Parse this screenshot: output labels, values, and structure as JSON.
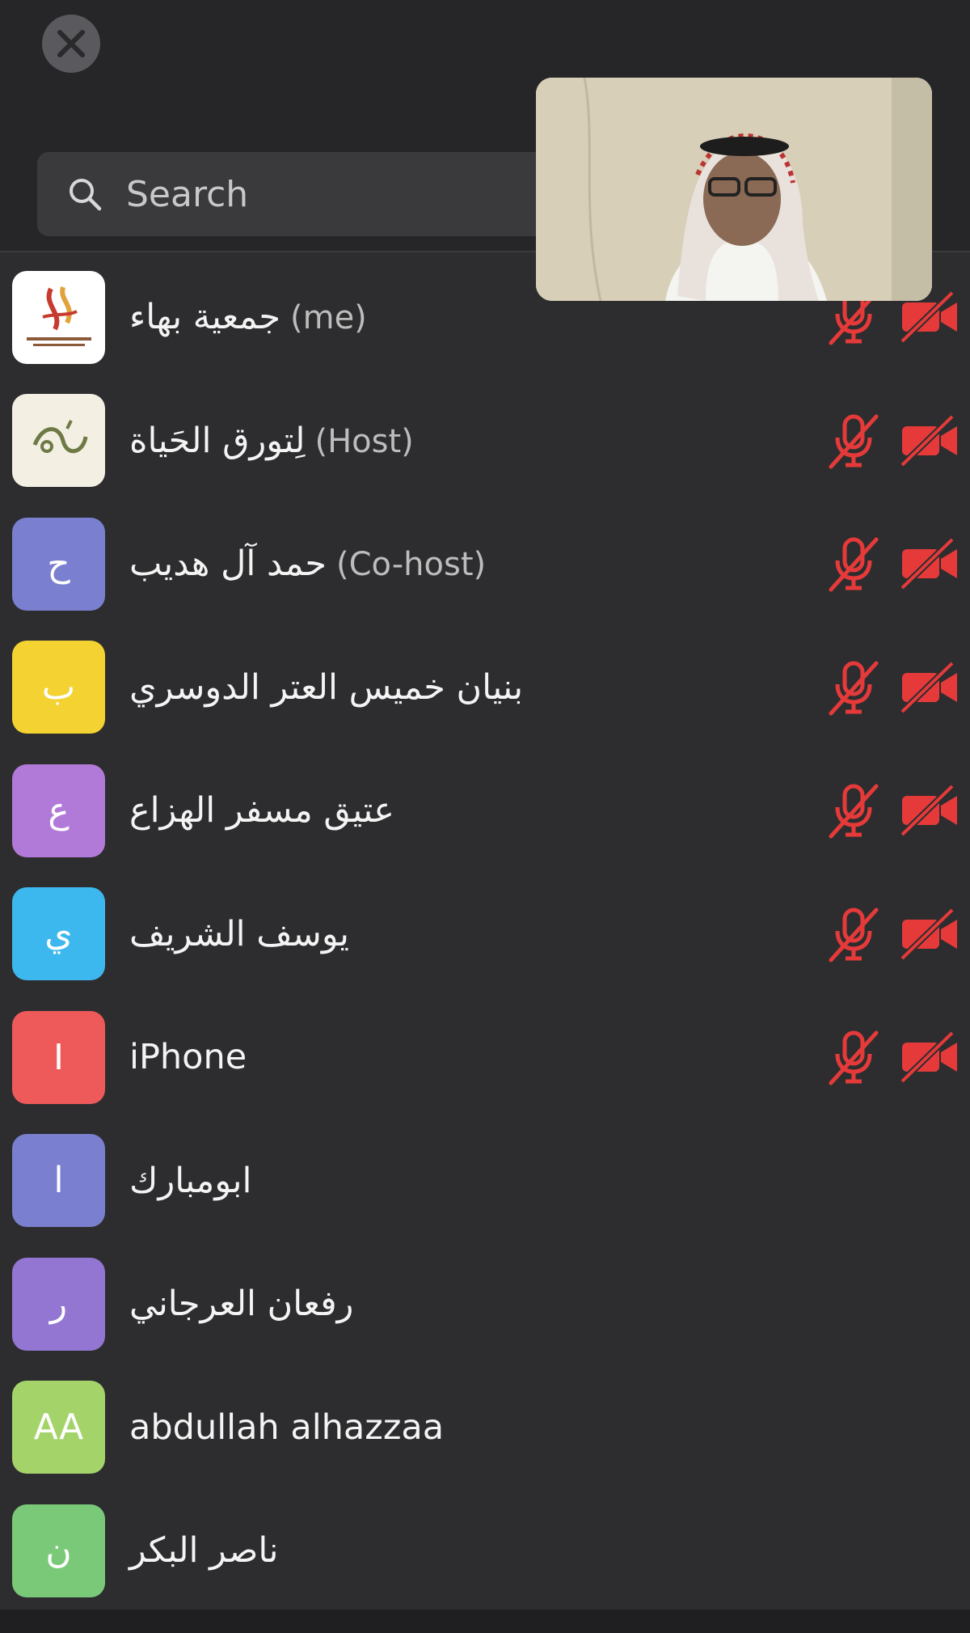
{
  "search": {
    "placeholder": "Search"
  },
  "participants": [
    {
      "name": "جمعية بهاء",
      "role": "(me)",
      "avatar_text": "",
      "avatar_color": "#ffffff",
      "muted": true,
      "video_off": true
    },
    {
      "name": "لِتورق الحَياة",
      "role": "(Host)",
      "avatar_text": "",
      "avatar_color": "#f3efe3",
      "muted": true,
      "video_off": true
    },
    {
      "name": "حمد آل هديب",
      "role": "(Co-host)",
      "avatar_text": "ح",
      "avatar_color": "#7a7fcf",
      "muted": true,
      "video_off": true
    },
    {
      "name": "بنيان خميس العتر الدوسري",
      "role": "",
      "avatar_text": "ب",
      "avatar_color": "#f3d231",
      "muted": true,
      "video_off": true
    },
    {
      "name": "عتيق مسفر الهزاع",
      "role": "",
      "avatar_text": "ع",
      "avatar_color": "#b27ad8",
      "muted": true,
      "video_off": true
    },
    {
      "name": "يوسف الشريف",
      "role": "",
      "avatar_text": "ي",
      "avatar_color": "#3db8ee",
      "muted": true,
      "video_off": true
    },
    {
      "name": "iPhone",
      "role": "",
      "avatar_text": "I",
      "avatar_color": "#ee5a5a",
      "muted": true,
      "video_off": true
    },
    {
      "name": "ابومبارك",
      "role": "",
      "avatar_text": "ا",
      "avatar_color": "#7a7fcf",
      "muted": false,
      "video_off": false
    },
    {
      "name": "رفعان العرجاني",
      "role": "",
      "avatar_text": "ر",
      "avatar_color": "#9276d2",
      "muted": false,
      "video_off": false
    },
    {
      "name": "abdullah alhazzaa",
      "role": "",
      "avatar_text": "AA",
      "avatar_color": "#a4d36a",
      "muted": false,
      "video_off": false
    },
    {
      "name": "ناصر البكر",
      "role": "",
      "avatar_text": "ن",
      "avatar_color": "#79c979",
      "muted": false,
      "video_off": false
    }
  ],
  "colors": {
    "muted_red": "#e63a3a",
    "background": "#2d2d2f",
    "topbar": "#262628"
  },
  "icons": {
    "close": "close-icon",
    "search": "search-icon",
    "mic_off": "mic-off-icon",
    "video_off": "video-off-icon"
  }
}
